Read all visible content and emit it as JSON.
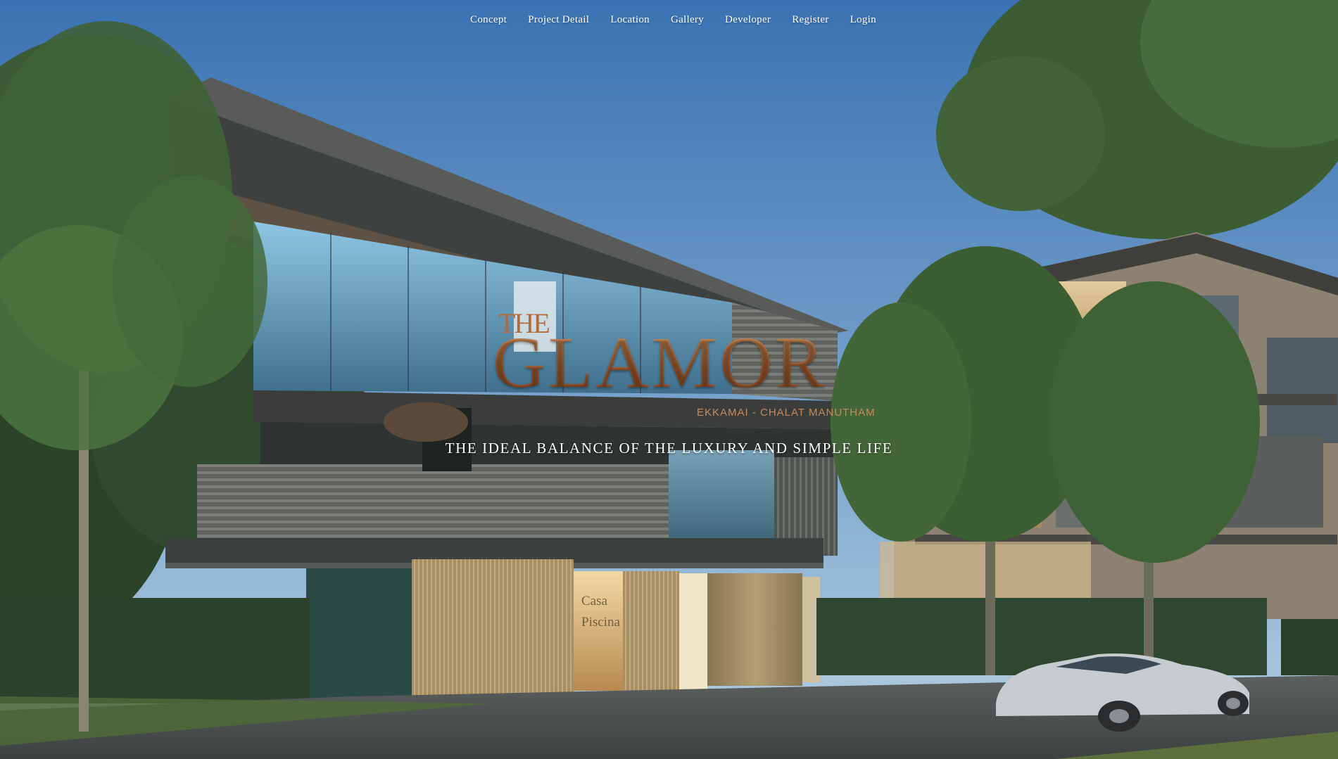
{
  "nav": {
    "items": [
      {
        "label": "Concept"
      },
      {
        "label": "Project Detail"
      },
      {
        "label": "Location"
      },
      {
        "label": "Gallery"
      },
      {
        "label": "Developer"
      },
      {
        "label": "Register"
      },
      {
        "label": "Login"
      }
    ]
  },
  "hero": {
    "logo_small": "THE",
    "logo_main": "GLAMOR",
    "logo_sub": "EKKAMAI - CHALAT MANUTHAM",
    "tagline": "THE IDEAL BALANCE OF THE LUXURY AND SIMPLE LIFE",
    "signage": [
      "Casa",
      "Piscina"
    ]
  },
  "colors": {
    "sky_top": "#3f78b8",
    "sky_bottom": "#9cc2dd",
    "logo_copper": "#b46a3d",
    "nav_text": "#ffffff",
    "foliage": "#2f4a2e"
  }
}
